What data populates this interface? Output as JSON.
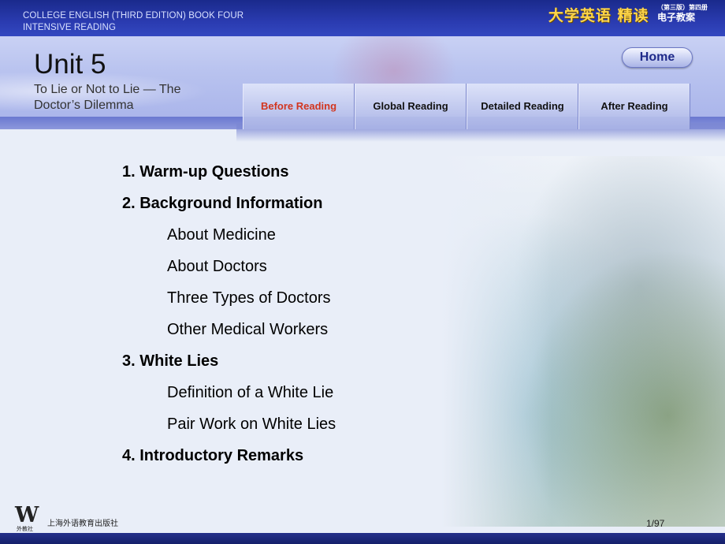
{
  "header": {
    "book_line1": "COLLEGE ENGLISH (THIRD EDITION) BOOK FOUR",
    "book_line2": "INTENSIVE READING",
    "cn_title": "大学英语 精读",
    "cn_edition": "（第三版）第四册",
    "cn_subtitle": "电子教案"
  },
  "unit": {
    "title": "Unit 5",
    "subtitle_line1": "To Lie or Not to Lie — The",
    "subtitle_line2": "Doctor’s Dilemma"
  },
  "home_label": "Home",
  "tabs": [
    {
      "label": "Before Reading",
      "active": true
    },
    {
      "label": "Global Reading",
      "active": false
    },
    {
      "label": "Detailed Reading",
      "active": false
    },
    {
      "label": "After Reading",
      "active": false
    }
  ],
  "menu": [
    {
      "label": "1. Warm-up Questions",
      "level": "head"
    },
    {
      "label": "2. Background Information",
      "level": "head"
    },
    {
      "label": "About Medicine",
      "level": "sub"
    },
    {
      "label": "About Doctors",
      "level": "sub"
    },
    {
      "label": "Three Types of Doctors",
      "level": "sub"
    },
    {
      "label": "Other Medical Workers",
      "level": "sub"
    },
    {
      "label": "3. White Lies",
      "level": "head"
    },
    {
      "label": "Definition of a White Lie",
      "level": "sub"
    },
    {
      "label": "Pair Work on White Lies",
      "level": "sub"
    },
    {
      "label": "4. Introductory Remarks",
      "level": "head"
    }
  ],
  "footer": {
    "logo_mark": "W",
    "logo_cn": "外教社",
    "publisher": "上海外语教育出版社",
    "page": "1/97"
  },
  "colors": {
    "active_tab": "#d2361f",
    "header_blue": "#2a3bb0",
    "cn_title_gold": "#ffd64a"
  }
}
